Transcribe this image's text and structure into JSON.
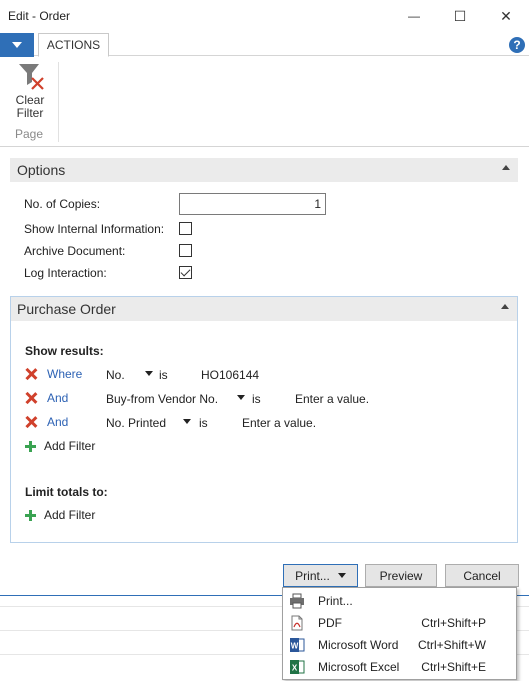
{
  "window": {
    "title": "Edit - Order",
    "minimize_glyph": "—",
    "maximize_glyph": "☐",
    "close_glyph": "✕"
  },
  "ribbon": {
    "tab_actions": "ACTIONS",
    "help_glyph": "?",
    "clear_filter_line1": "Clear",
    "clear_filter_line2": "Filter",
    "group_label": "Page"
  },
  "options": {
    "header": "Options",
    "no_of_copies_label": "No. of Copies:",
    "no_of_copies_value": "1",
    "show_internal_label": "Show Internal Information:",
    "show_internal_checked": false,
    "archive_label": "Archive Document:",
    "archive_checked": false,
    "log_interaction_label": "Log Interaction:",
    "log_interaction_checked": true
  },
  "purchase_order": {
    "header": "Purchase Order",
    "show_results_label": "Show results:",
    "filters": [
      {
        "connector": "Where",
        "field": "No.",
        "op": "is",
        "value": "HO106144"
      },
      {
        "connector": "And",
        "field": "Buy-from Vendor No.",
        "op": "is",
        "value": "Enter a value."
      },
      {
        "connector": "And",
        "field": "No. Printed",
        "op": "is",
        "value": "Enter a value."
      }
    ],
    "add_filter_label": "Add Filter",
    "limit_totals_label": "Limit totals to:",
    "add_filter_label_2": "Add Filter"
  },
  "buttons": {
    "print": "Print...",
    "preview": "Preview",
    "cancel": "Cancel"
  },
  "print_menu": [
    {
      "label": "Print...",
      "shortcut": "",
      "icon": "printer-icon"
    },
    {
      "label": "PDF",
      "shortcut": "Ctrl+Shift+P",
      "icon": "pdf-icon"
    },
    {
      "label": "Microsoft Word",
      "shortcut": "Ctrl+Shift+W",
      "icon": "word-icon"
    },
    {
      "label": "Microsoft Excel",
      "shortcut": "Ctrl+Shift+E",
      "icon": "excel-icon"
    }
  ],
  "colors": {
    "accent": "#2f6fb7",
    "filter_link": "#2d62b4",
    "remove_red": "#d0402b",
    "add_green": "#3aa352",
    "word_blue": "#2b579a",
    "excel_green": "#217346"
  }
}
